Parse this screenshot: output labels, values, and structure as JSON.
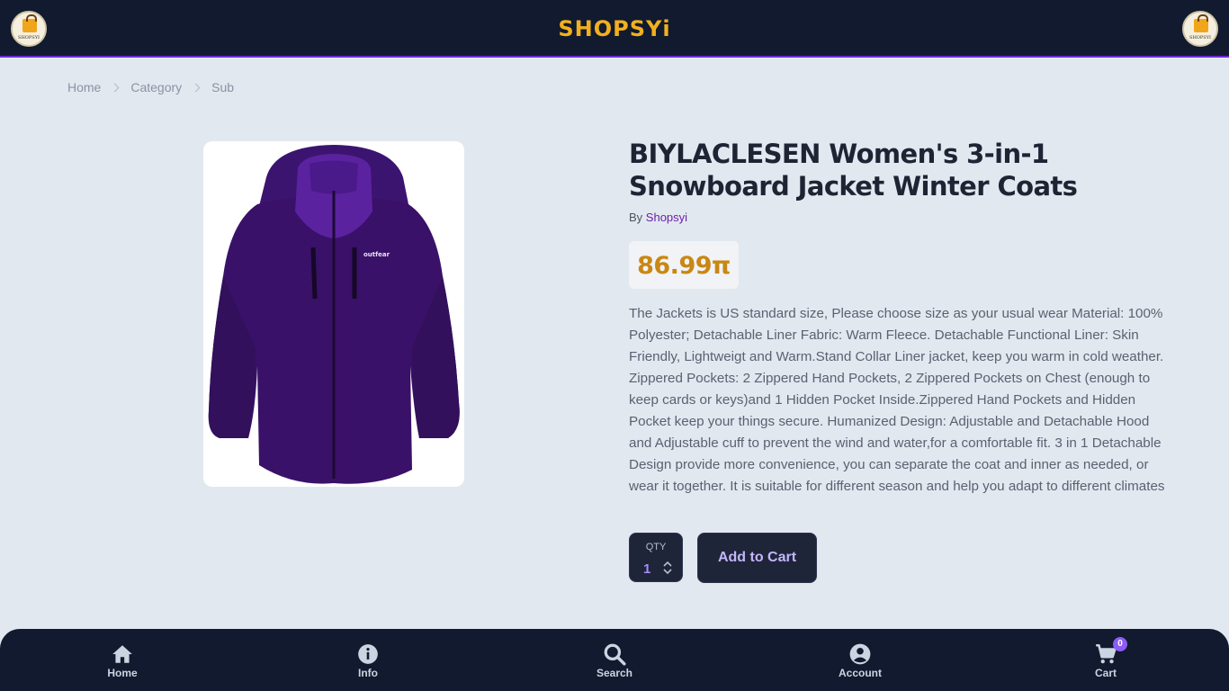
{
  "header": {
    "brand": "SHOPSYi",
    "logo_text": "SHOPSYI"
  },
  "breadcrumb": [
    "Home",
    "Category",
    "Sub"
  ],
  "product": {
    "title": "BIYLACLESEN Women's 3-in-1 Snowboard Jacket Winter Coats",
    "by_label": "By",
    "seller": "Shopsyi",
    "price": "86.99π",
    "description": "The Jackets is US standard size, Please choose size as your usual wear Material: 100% Polyester; Detachable Liner Fabric: Warm Fleece. Detachable Functional Liner: Skin Friendly, Lightweigt and Warm.Stand Collar Liner jacket, keep you warm in cold weather. Zippered Pockets: 2 Zippered Hand Pockets, 2 Zippered Pockets on Chest (enough to keep cards or keys)and 1 Hidden Pocket Inside.Zippered Hand Pockets and Hidden Pocket keep your things secure. Humanized Design: Adjustable and Detachable Hood and Adjustable cuff to prevent the wind and water,for a comfortable fit. 3 in 1 Detachable Design provide more convenience, you can separate the coat and inner as needed, or wear it together. It is suitable for different season and help you adapt to different climates",
    "jacket_brand_mark": "outfear"
  },
  "purchase": {
    "qty_label": "QTY",
    "qty_value": "1",
    "add_to_cart": "Add to Cart"
  },
  "bottom_nav": {
    "home": "Home",
    "info": "Info",
    "search": "Search",
    "account": "Account",
    "cart": "Cart",
    "cart_count": "0"
  },
  "colors": {
    "header_bg": "#111a2e",
    "brand": "#f2b01e",
    "accent_purple": "#6b21a8",
    "price": "#c98714",
    "page_bg": "#e2e8f0"
  }
}
